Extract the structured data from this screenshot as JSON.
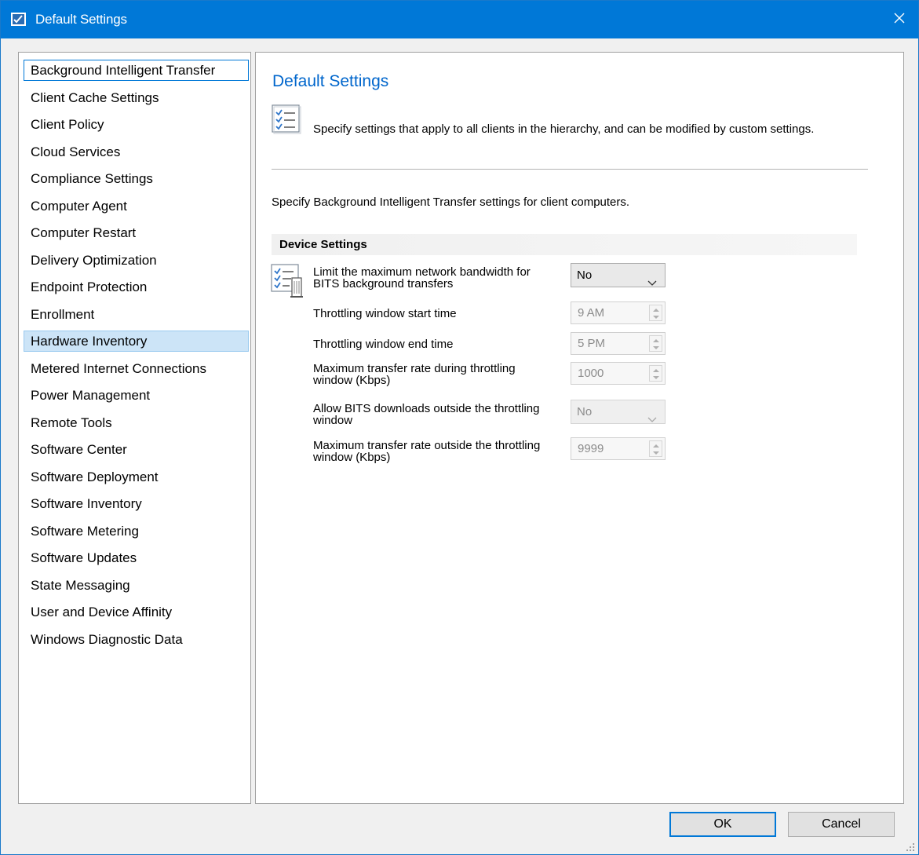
{
  "window": {
    "title": "Default Settings",
    "close_glyph": "✕"
  },
  "nav": {
    "items": [
      {
        "label": "Background Intelligent Transfer",
        "state": "focused"
      },
      {
        "label": "Client Cache Settings"
      },
      {
        "label": "Client Policy"
      },
      {
        "label": "Cloud Services"
      },
      {
        "label": "Compliance Settings"
      },
      {
        "label": "Computer Agent"
      },
      {
        "label": "Computer Restart"
      },
      {
        "label": "Delivery Optimization"
      },
      {
        "label": "Endpoint Protection"
      },
      {
        "label": "Enrollment"
      },
      {
        "label": "Hardware Inventory",
        "state": "selected"
      },
      {
        "label": "Metered Internet Connections"
      },
      {
        "label": "Power Management"
      },
      {
        "label": "Remote Tools"
      },
      {
        "label": "Software Center"
      },
      {
        "label": "Software Deployment"
      },
      {
        "label": "Software Inventory"
      },
      {
        "label": "Software Metering"
      },
      {
        "label": "Software Updates"
      },
      {
        "label": "State Messaging"
      },
      {
        "label": "User and Device Affinity"
      },
      {
        "label": "Windows Diagnostic Data"
      }
    ]
  },
  "content": {
    "title": "Default Settings",
    "description": "Specify settings that apply to all clients in the hierarchy, and can be modified by custom settings.",
    "section_description": "Specify Background Intelligent Transfer settings for client computers.",
    "group_header": "Device Settings",
    "settings": {
      "limit_bandwidth": {
        "label_line1": "Limit the maximum network bandwidth for",
        "label_line2": "BITS background transfers",
        "value": "No"
      },
      "start_time": {
        "label": "Throttling window start time",
        "value": "9 AM"
      },
      "end_time": {
        "label": "Throttling window end time",
        "value": "5 PM"
      },
      "rate_during": {
        "label_line1": "Maximum transfer rate during throttling",
        "label_line2": "window (Kbps)",
        "value": "1000"
      },
      "allow_outside": {
        "label_line1": "Allow BITS downloads outside the throttling",
        "label_line2": "window",
        "value": "No"
      },
      "rate_outside": {
        "label_line1": "Maximum transfer rate outside the throttling",
        "label_line2": "window (Kbps)",
        "value": "9999"
      }
    }
  },
  "buttons": {
    "ok": "OK",
    "cancel": "Cancel"
  },
  "colors": {
    "titlebar": "#0078d7",
    "accent_title": "#0066cc",
    "selection": "#cce4f7"
  },
  "icons": {
    "title": "settings-checklist-icon",
    "close": "close-icon",
    "content": "checklist-icon",
    "setting": "checklist-server-icon",
    "dropdown": "chevron-down-icon",
    "spin": "spin-arrows-icon",
    "grip": "resize-grip-icon"
  }
}
